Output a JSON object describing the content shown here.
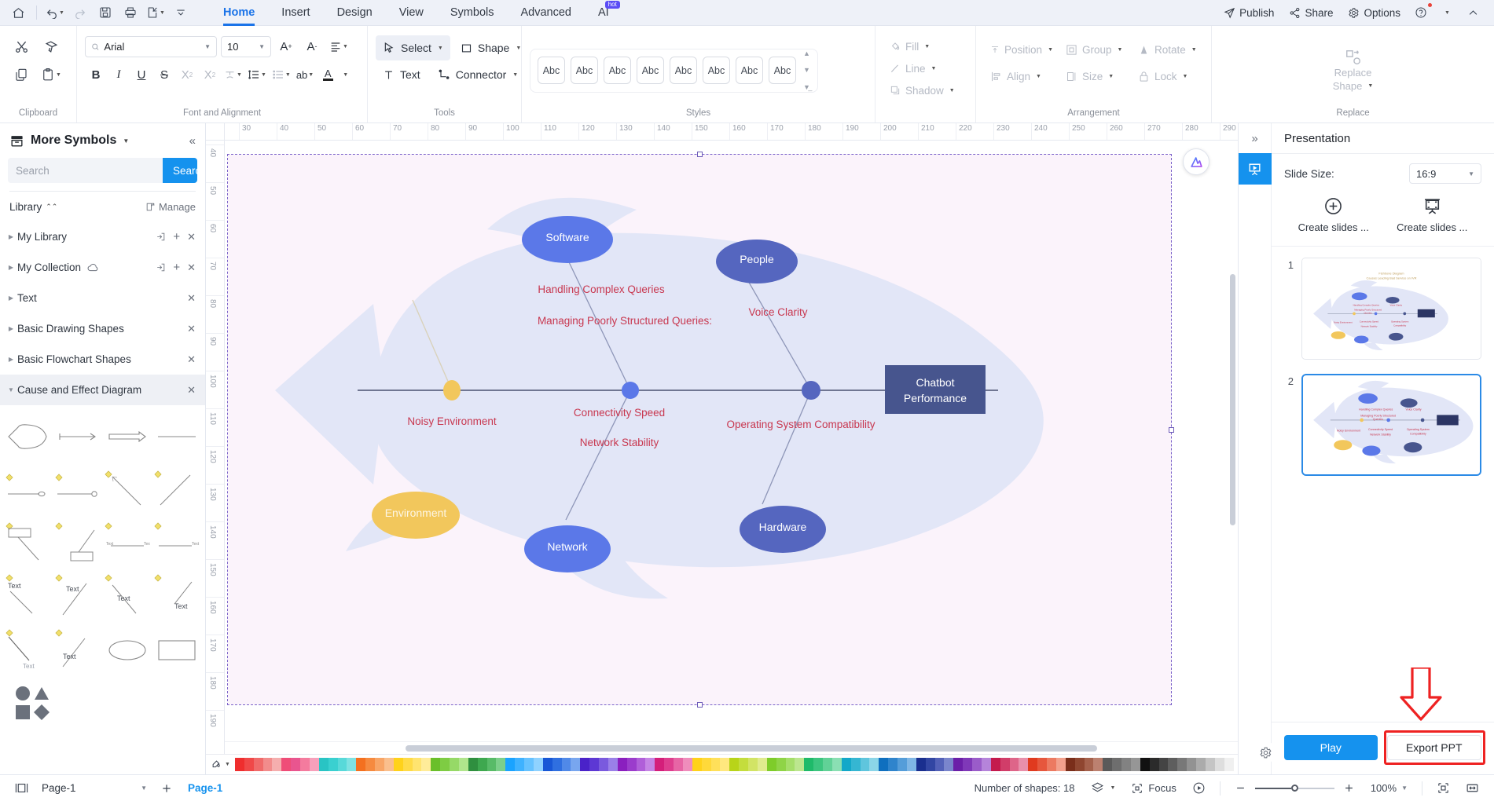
{
  "titlebar": {
    "home_icon": "home-icon",
    "quick_actions": [
      {
        "name": "undo-button",
        "glyph": "undo",
        "caret": true,
        "disabled": false
      },
      {
        "name": "redo-button",
        "glyph": "redo",
        "caret": false,
        "disabled": true
      },
      {
        "name": "save-button",
        "glyph": "save",
        "caret": false,
        "disabled": false
      },
      {
        "name": "print-button",
        "glyph": "print",
        "caret": false,
        "disabled": false
      },
      {
        "name": "export-button",
        "glyph": "export",
        "caret": true,
        "disabled": false
      },
      {
        "name": "customize-qat-button",
        "glyph": "chevron",
        "caret": false,
        "disabled": false
      }
    ],
    "tabs": [
      {
        "label": "Home",
        "active": true
      },
      {
        "label": "Insert",
        "active": false
      },
      {
        "label": "Design",
        "active": false
      },
      {
        "label": "View",
        "active": false
      },
      {
        "label": "Symbols",
        "active": false
      },
      {
        "label": "Advanced",
        "active": false
      },
      {
        "label": "AI",
        "active": false,
        "badge": "hot"
      }
    ],
    "right_items": [
      {
        "label": "Publish",
        "icon": "publish-icon"
      },
      {
        "label": "Share",
        "icon": "share-icon"
      },
      {
        "label": "Options",
        "icon": "gear-icon"
      }
    ],
    "help_icon": "help-icon",
    "collapse_icon": "chevron-up-icon"
  },
  "ribbon": {
    "groups": [
      {
        "label": "Clipboard"
      },
      {
        "label": "Font and Alignment"
      },
      {
        "label": "Tools"
      },
      {
        "label": "Styles"
      },
      {
        "label": ""
      },
      {
        "label": "Arrangement"
      },
      {
        "label": "Replace"
      }
    ],
    "font": {
      "family_value": "Arial",
      "family_placeholder": "Arial",
      "size_value": "10"
    },
    "tools": [
      {
        "label": "Select",
        "icon": "cursor-icon",
        "caret": true,
        "selected": true
      },
      {
        "label": "Shape",
        "icon": "square-icon",
        "caret": true,
        "selected": false
      },
      {
        "label": "Text",
        "icon": "text-icon",
        "caret": false,
        "selected": false
      },
      {
        "label": "Connector",
        "icon": "connector-icon",
        "caret": true,
        "selected": false
      }
    ],
    "styles": {
      "items": [
        "Abc",
        "Abc",
        "Abc",
        "Abc",
        "Abc",
        "Abc",
        "Abc",
        "Abc"
      ]
    },
    "format": [
      {
        "label": "Fill",
        "icon": "fill-icon"
      },
      {
        "label": "Line",
        "icon": "line-icon"
      },
      {
        "label": "Shadow",
        "icon": "shadow-icon"
      }
    ],
    "arrangement": [
      {
        "label": "Position",
        "icon": "position-icon"
      },
      {
        "label": "Group",
        "icon": "group-icon"
      },
      {
        "label": "Rotate",
        "icon": "rotate-icon"
      },
      {
        "label": "Align",
        "icon": "align-icon"
      },
      {
        "label": "Size",
        "icon": "size-icon"
      },
      {
        "label": "Lock",
        "icon": "lock-icon"
      }
    ],
    "replace": {
      "label_line1": "Replace",
      "label_line2": "Shape",
      "icon": "replace-shape-icon"
    }
  },
  "left_panel": {
    "title": "More Symbols",
    "collapse_icon": "collapse-left-icon",
    "search": {
      "value": "",
      "placeholder": "Search",
      "button_label": "Search"
    },
    "library_label": "Library",
    "manage_label": "Manage",
    "categories": [
      {
        "label": "My Library",
        "expanded": false,
        "has_import": true,
        "has_add": true,
        "has_close": true,
        "cloud": false
      },
      {
        "label": "My Collection",
        "expanded": false,
        "has_import": true,
        "has_add": true,
        "has_close": true,
        "cloud": true
      },
      {
        "label": "Text",
        "expanded": false,
        "has_import": false,
        "has_add": false,
        "has_close": true,
        "cloud": false
      },
      {
        "label": "Basic Drawing Shapes",
        "expanded": false,
        "has_import": false,
        "has_add": false,
        "has_close": true,
        "cloud": false
      },
      {
        "label": "Basic Flowchart Shapes",
        "expanded": false,
        "has_import": false,
        "has_add": false,
        "has_close": true,
        "cloud": false
      },
      {
        "label": "Cause and Effect Diagram",
        "expanded": true,
        "has_import": false,
        "has_add": false,
        "has_close": true,
        "cloud": false
      }
    ],
    "shape_text_label": "Text"
  },
  "canvas": {
    "ruler_h_ticks": [
      "30",
      "40",
      "50",
      "60",
      "70",
      "80",
      "90",
      "100",
      "110",
      "120",
      "130",
      "140",
      "150",
      "160",
      "170",
      "180",
      "190",
      "200",
      "210",
      "220",
      "230",
      "240",
      "250",
      "260",
      "270",
      "280",
      "290"
    ],
    "ruler_v_ticks": [
      "40",
      "50",
      "60",
      "70",
      "80",
      "90",
      "100",
      "110",
      "120",
      "130",
      "140",
      "150",
      "160",
      "170",
      "180",
      "190"
    ],
    "ai_icon": "ai-assistant-icon",
    "diagram": {
      "title": "Fishbone Diagram",
      "head_label": "Chatbot Performance",
      "bones": [
        {
          "name": "Software",
          "color": "#5b78e8",
          "causes": [
            "Handling Complex Queries",
            "Managing Poorly Structured Queries:"
          ]
        },
        {
          "name": "People",
          "color": "#5566bf",
          "causes": [
            "Voice Clarity"
          ]
        },
        {
          "name": "Environment",
          "color": "#f2c75c",
          "causes": [
            "Noisy Environment"
          ]
        },
        {
          "name": "Network",
          "color": "#5b78e8",
          "causes": [
            "Connectivity Speed",
            "Network Stability"
          ]
        },
        {
          "name": "Hardware",
          "color": "#5566bf",
          "causes": [
            "Operating System Compatibility"
          ]
        }
      ],
      "cause_text_color": "#c8374f",
      "head_box_color": "#47558e"
    },
    "colorbar": {
      "picker_icon": "color-picker-icon",
      "colors": [
        "#ef2e2e",
        "#f04848",
        "#f06a6a",
        "#f28c8c",
        "#f5aeae",
        "#ef4d78",
        "#e9558f",
        "#f47b9e",
        "#f7a0bb",
        "#29c4c4",
        "#3ad0d0",
        "#58d9d9",
        "#7ee2e2",
        "#f4701f",
        "#f68a3f",
        "#f8a566",
        "#fabf8d",
        "#ffd21a",
        "#ffdb47",
        "#ffe470",
        "#ffec99",
        "#6abf2a",
        "#7ecc43",
        "#96d967",
        "#b0e58c",
        "#2f8f3f",
        "#3ea84f",
        "#58bb68",
        "#7ccf8a",
        "#1aa3ff",
        "#3fb2ff",
        "#66c2ff",
        "#8fd2ff",
        "#1857d6",
        "#2f6fe0",
        "#5089e8",
        "#78a6ef",
        "#4a22c9",
        "#5d38d4",
        "#7a5ade",
        "#9a80e8",
        "#8a1fbf",
        "#9b3ccc",
        "#b05fd9",
        "#c585e5",
        "#d41f7a",
        "#de3d8e",
        "#e765a5",
        "#ef8dbc",
        "#ffd21a",
        "#ffd93a",
        "#ffe05a",
        "#ffe87f",
        "#b8d419",
        "#c4dd3d",
        "#d2e465",
        "#e0eb8e",
        "#7ecc2a",
        "#8fd447",
        "#a5de6a",
        "#bce68f",
        "#1fba6a",
        "#3cc57f",
        "#61d197",
        "#8adfb3",
        "#13a8c9",
        "#35b6d2",
        "#5fc5dd",
        "#8bd5e8",
        "#0f6fbf",
        "#2f84cc",
        "#559dd9",
        "#7fb6e5",
        "#1a2f8f",
        "#3246a3",
        "#5361b8",
        "#7a85cc",
        "#6b1fa8",
        "#7f38b8",
        "#9a5cc9",
        "#b584da",
        "#c41a4d",
        "#d13d69",
        "#de6589",
        "#e88fab",
        "#e03a1f",
        "#e6573d",
        "#ec7a61",
        "#f2a08c",
        "#7a2e1a",
        "#8f4630",
        "#a5614c",
        "#bc8170",
        "#5a5a5a",
        "#6e6e6e",
        "#828282",
        "#969696",
        "#111111",
        "#2b2b2b",
        "#444444",
        "#5e5e5e",
        "#787878",
        "#929292",
        "#ababab",
        "#c5c5c5",
        "#dedede",
        "#f0f0f0"
      ]
    }
  },
  "right_panel": {
    "expand_icon": "expand-right-icon",
    "tab_icon": "presentation-icon",
    "title": "Presentation",
    "slide_size_label": "Slide Size:",
    "slide_size_value": "16:9",
    "create_buttons": [
      {
        "label": "Create slides ...",
        "icon": "plus-circle-icon"
      },
      {
        "label": "Create slides ...",
        "icon": "slide-frame-icon"
      }
    ],
    "slides": [
      {
        "number": "1",
        "selected": false,
        "has_title": true
      },
      {
        "number": "2",
        "selected": true,
        "has_title": false
      }
    ],
    "play_label": "Play",
    "export_label": "Export PPT",
    "gear_icon": "gear-icon",
    "highlight_color": "#ee2222"
  },
  "statusbar": {
    "page_panel_icon": "page-panel-icon",
    "page_select_value": "Page-1",
    "add_page_icon": "plus-icon",
    "page_tab_label": "Page-1",
    "shapes_label": "Number of shapes: 18",
    "layers_icon": "layers-icon",
    "focus_label": "Focus",
    "focus_icon": "focus-icon",
    "play_icon": "play-circle-icon",
    "zoom_out_icon": "minus-icon",
    "zoom_in_icon": "plus-icon",
    "zoom_value": "100%",
    "fit_page_icon": "fit-page-icon",
    "fit_width_icon": "fit-width-icon"
  }
}
